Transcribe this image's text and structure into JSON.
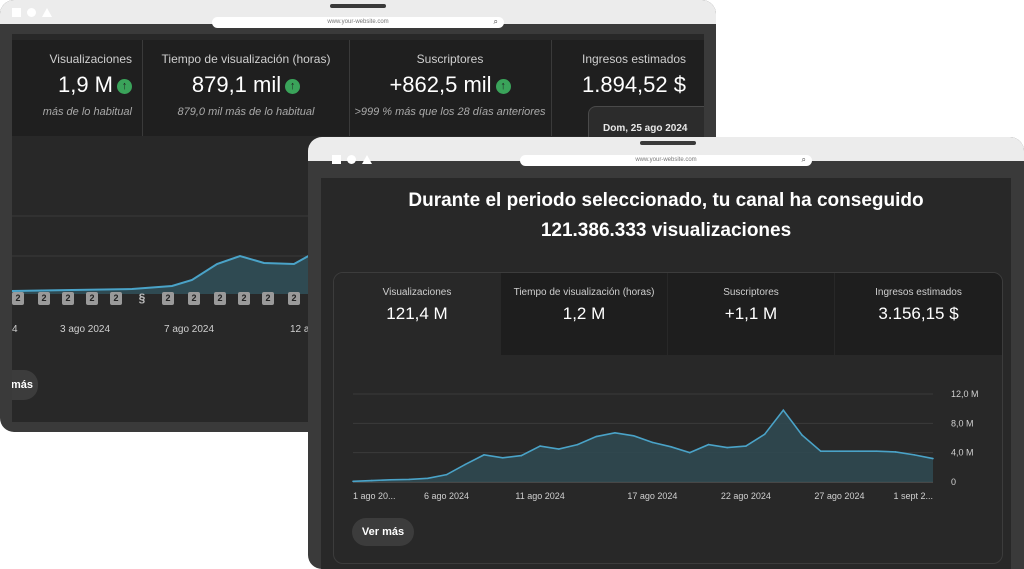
{
  "back_window": {
    "url": "www.your-website.com",
    "metrics": [
      {
        "label": "Visualizaciones",
        "value": "1,9 M",
        "subtitle": "más de lo habitual"
      },
      {
        "label": "Tiempo de visualización (horas)",
        "value": "879,1 mil",
        "subtitle": "879,0 mil más de lo habitual"
      },
      {
        "label": "Suscriptores",
        "value": "+862,5 mil",
        "subtitle": ">999 % más que los 28 días anteriores"
      },
      {
        "label": "Ingresos estimados",
        "value": "1.894,52 $",
        "tooltip_date": "Dom, 25 ago 2024"
      }
    ],
    "x_ticks": [
      "4",
      "3 ago 2024",
      "7 ago 2024",
      "12 a"
    ],
    "badge_label": "2",
    "more_button": "más"
  },
  "front_window": {
    "url": "www.your-website.com",
    "headline_line1": "Durante el periodo seleccionado, tu canal ha conseguido",
    "headline_line2": "121.386.333 visualizaciones",
    "metrics": [
      {
        "label": "Visualizaciones",
        "value": "121,4 M"
      },
      {
        "label": "Tiempo de visualización (horas)",
        "value": "1,2 M"
      },
      {
        "label": "Suscriptores",
        "value": "+1,1 M"
      },
      {
        "label": "Ingresos estimados",
        "value": "3.156,15 $"
      }
    ],
    "more_button": "Ver más"
  },
  "colors": {
    "line": "#4aa3c8",
    "fill": "#2f4a52",
    "up_arrow": "#3aa35a"
  },
  "chart_data": {
    "type": "area",
    "x_tick_labels": [
      "1 ago 20...",
      "6 ago 2024",
      "11 ago 2024",
      "17 ago 2024",
      "22 ago 2024",
      "27 ago 2024",
      "1 sept 2..."
    ],
    "y_tick_labels": [
      "12,0 M",
      "8,0 M",
      "4,0 M",
      "0"
    ],
    "ylim": [
      0,
      12
    ],
    "x": [
      1,
      2,
      3,
      4,
      5,
      6,
      7,
      8,
      9,
      10,
      11,
      12,
      13,
      14,
      15,
      16,
      17,
      18,
      19,
      20,
      21,
      22,
      23,
      24,
      25,
      26,
      27,
      28,
      29,
      30,
      31,
      32
    ],
    "values": [
      0.1,
      0.2,
      0.3,
      0.35,
      0.5,
      1.0,
      2.4,
      3.7,
      3.3,
      3.6,
      4.9,
      4.5,
      5.1,
      6.2,
      6.7,
      6.3,
      5.4,
      4.8,
      4.0,
      5.1,
      4.7,
      4.9,
      6.5,
      9.8,
      6.4,
      4.2,
      4.2,
      4.2,
      4.2,
      4.1,
      3.7,
      3.2
    ],
    "series": [
      {
        "values": [
          0.1,
          0.2,
          0.3,
          0.35,
          0.5,
          1.0,
          2.4,
          3.7,
          3.3,
          3.6,
          4.9,
          4.5,
          5.1,
          6.2,
          6.7,
          6.3,
          5.4,
          4.8,
          4.0,
          5.1,
          4.7,
          4.9,
          6.5,
          9.8,
          6.4,
          4.2,
          4.2,
          4.2,
          4.2,
          4.1,
          3.7,
          3.2
        ]
      }
    ],
    "grid": true
  }
}
